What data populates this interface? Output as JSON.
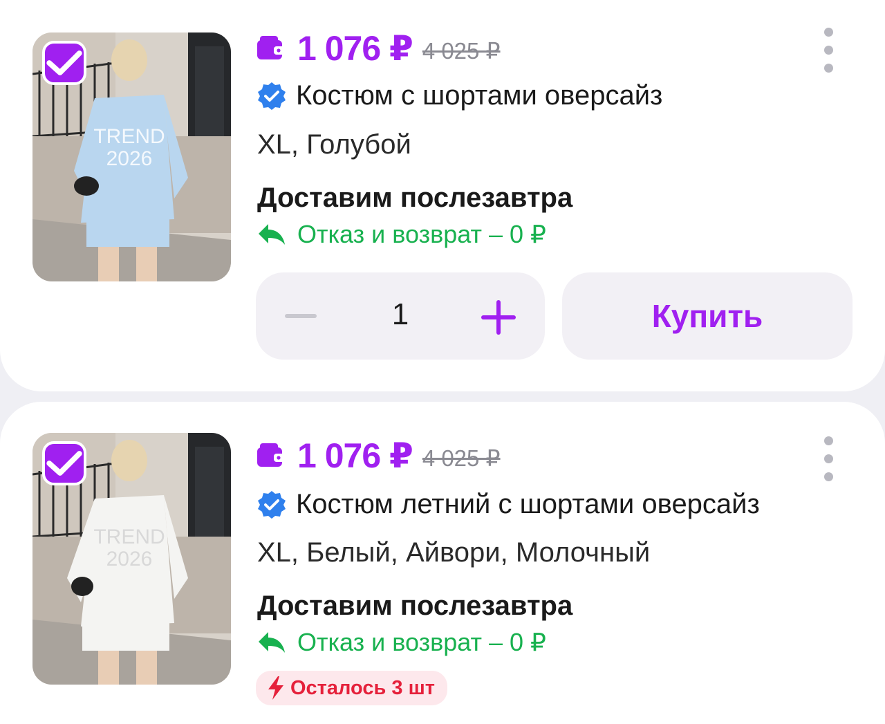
{
  "items": [
    {
      "price": "1 076 ₽",
      "old_price": "4 025 ₽",
      "title": "Костюм с шортами оверсайз",
      "variant": "XL, Голубой",
      "delivery": "Доставим послезавтра",
      "return": "Отказ и возврат – 0 ₽",
      "quantity": "1",
      "buy_label": "Купить",
      "photo_text_line1": "TREND",
      "photo_text_line2": "2026",
      "outfit_color": "#b9d6ef"
    },
    {
      "price": "1 076 ₽",
      "old_price": "4 025 ₽",
      "title": "Костюм летний с шортами оверсайз",
      "variant": "XL, Белый, Айвори, Молочный",
      "delivery": "Доставим послезавтра",
      "return": "Отказ и возврат – 0 ₽",
      "stock": "Осталось 3 шт",
      "photo_text_line1": "TREND",
      "photo_text_line2": "2026",
      "outfit_color": "#f4f4f2"
    }
  ],
  "colors": {
    "accent": "#a020f0",
    "green": "#18b14f",
    "red": "#e5213b",
    "verified": "#2f80ed"
  },
  "icons": [
    "checkbox-checked-icon",
    "wallet-icon",
    "verified-badge-icon",
    "return-arrow-icon",
    "more-vertical-icon",
    "minus-icon",
    "plus-icon",
    "lightning-icon"
  ]
}
